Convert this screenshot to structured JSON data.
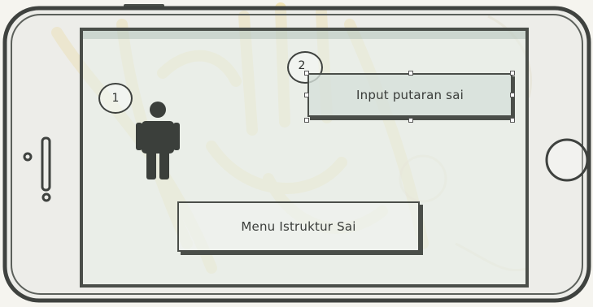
{
  "callouts": {
    "first": "1",
    "second": "2"
  },
  "buttons": {
    "input_label": "Input putaran sai",
    "menu_label": "Menu Istruktur Sai"
  },
  "icons": {
    "person": "person-icon",
    "home_button": "home-button-icon"
  },
  "colors": {
    "outline": "#4a4e49",
    "screen_tint": "#e8eee8",
    "watermark": "#f3d98a"
  }
}
